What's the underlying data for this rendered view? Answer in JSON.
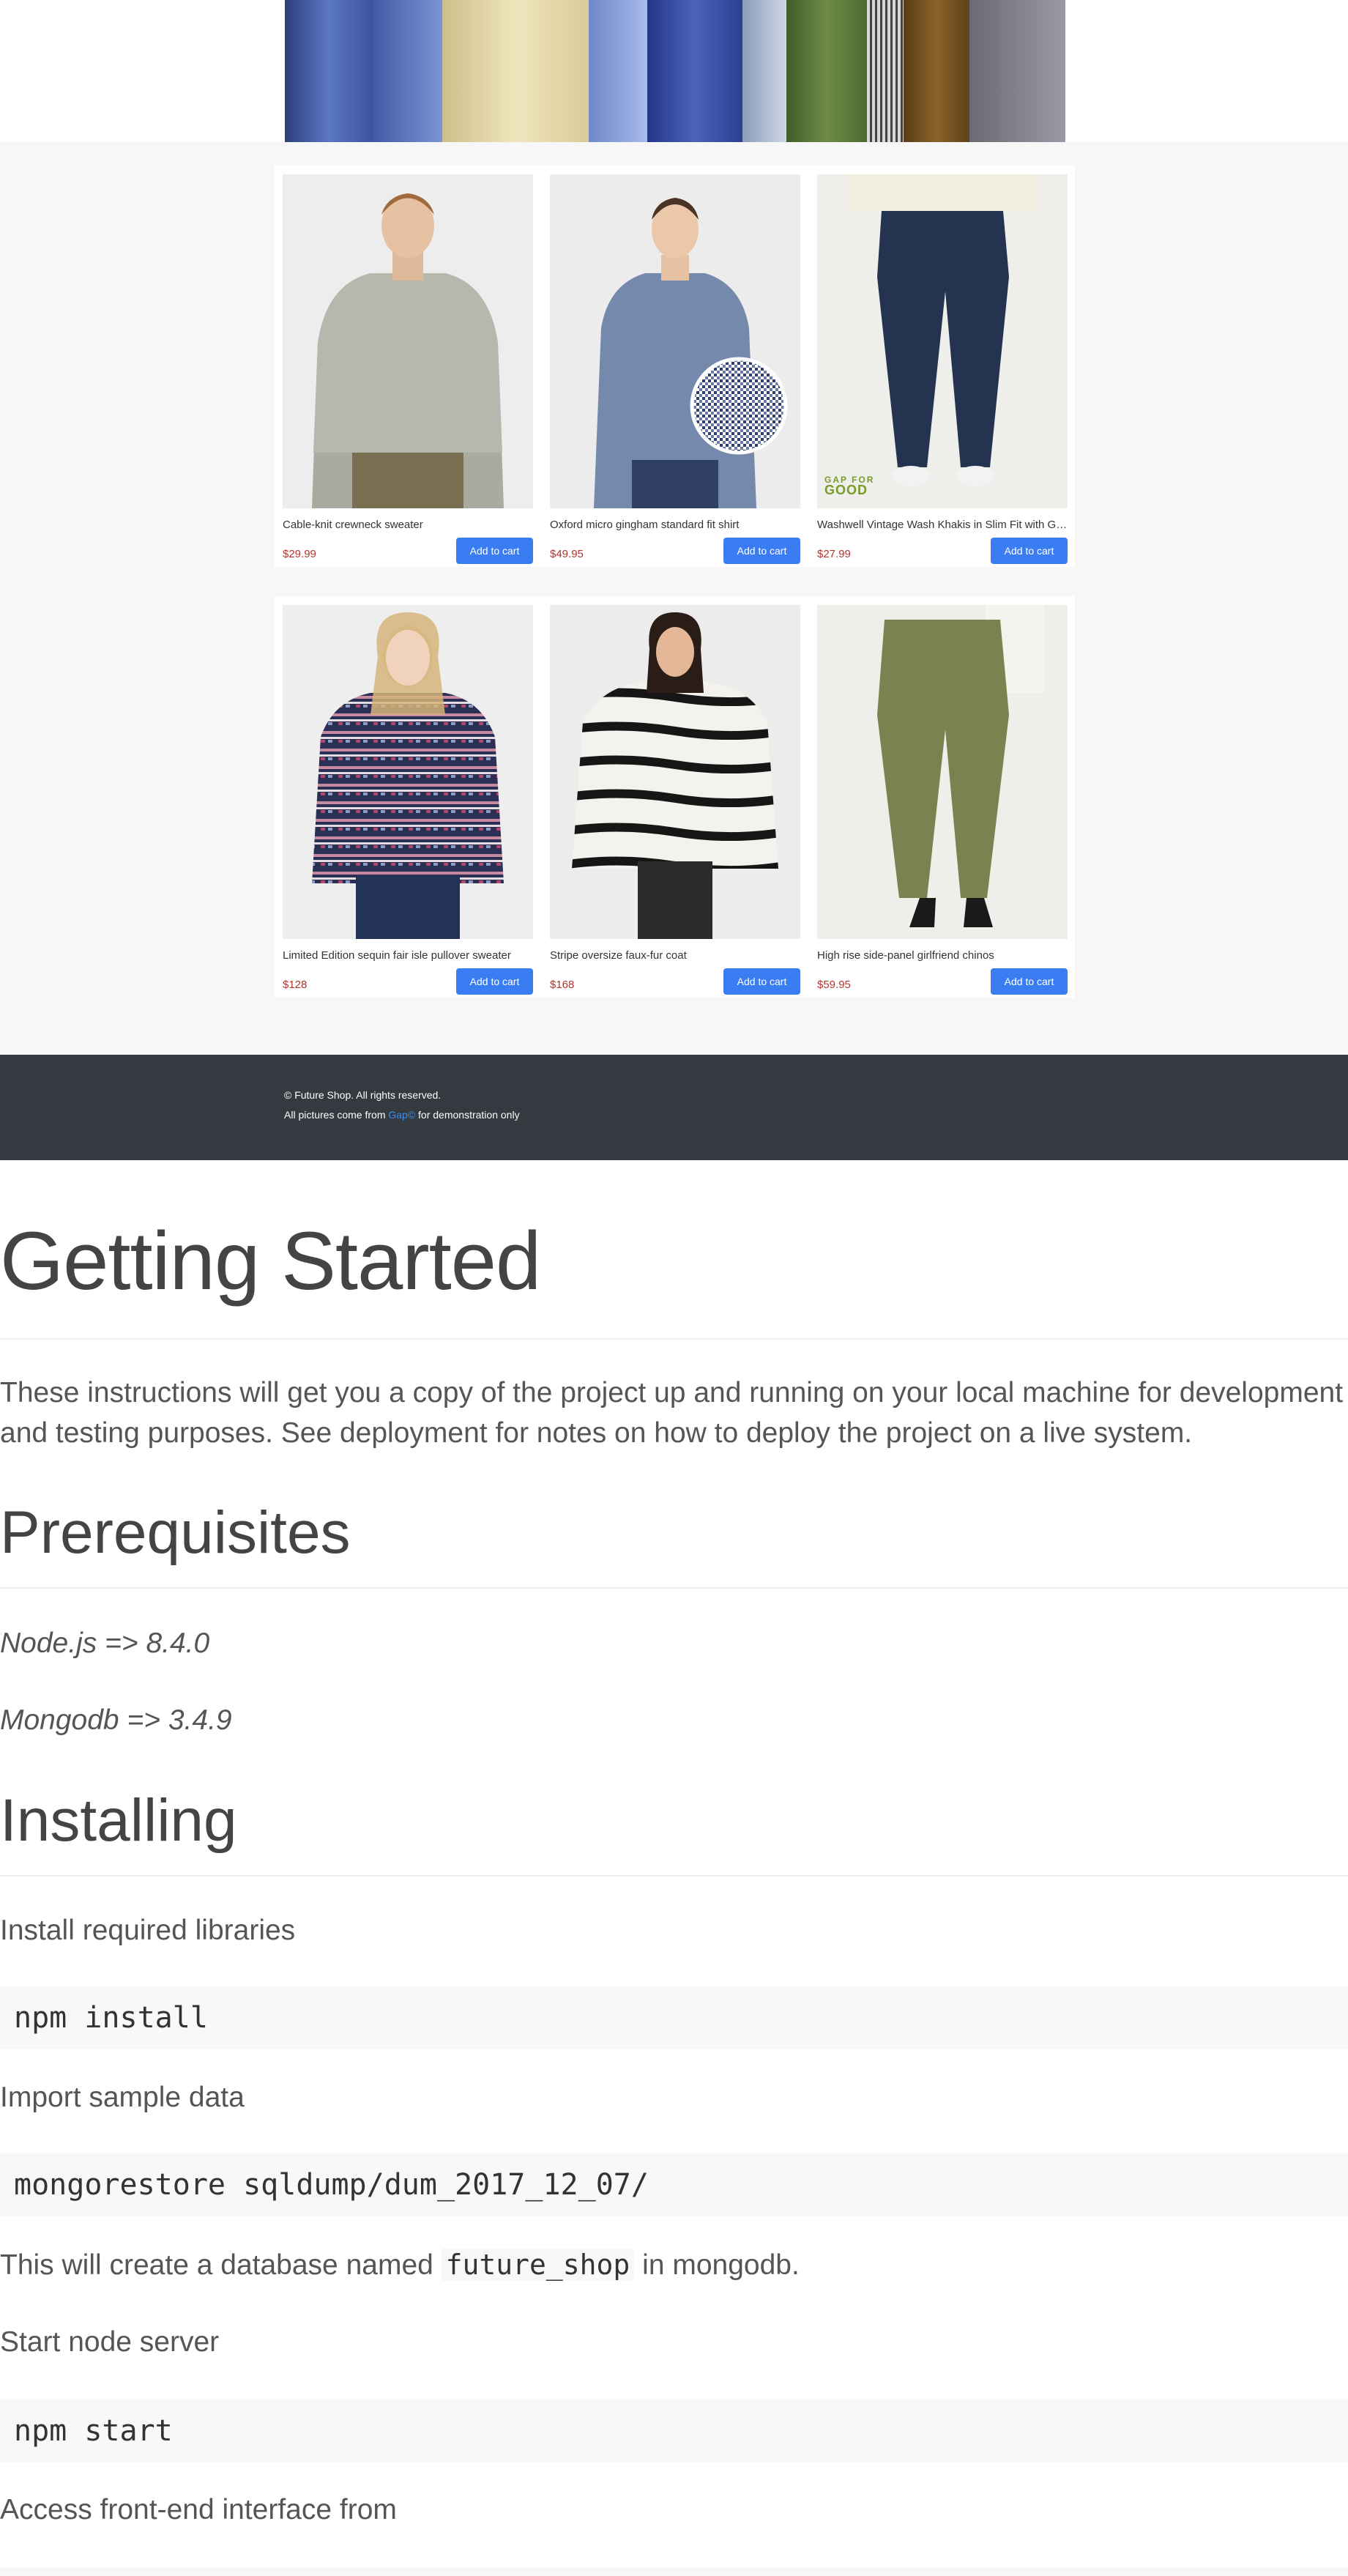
{
  "shop": {
    "products": [
      {
        "name": "Cable-knit crewneck sweater",
        "price": "$29.99",
        "cart_label": "Add to cart"
      },
      {
        "name": "Oxford micro gingham standard fit shirt",
        "price": "$49.95",
        "cart_label": "Add to cart"
      },
      {
        "name": "Washwell Vintage Wash Khakis in Slim Fit with GapFlex",
        "price": "$27.99",
        "cart_label": "Add to cart",
        "badge_top": "GAP FOR",
        "badge_bottom": "GOOD"
      },
      {
        "name": "Limited Edition sequin fair isle pullover sweater",
        "price": "$128",
        "cart_label": "Add to cart"
      },
      {
        "name": "Stripe oversize faux-fur coat",
        "price": "$168",
        "cart_label": "Add to cart"
      },
      {
        "name": "High rise side-panel girlfriend chinos",
        "price": "$59.95",
        "cart_label": "Add to cart"
      }
    ],
    "footer": {
      "copyright": "© Future Shop. All rights reserved.",
      "pictures_prefix": "All pictures come from ",
      "pictures_link": "Gap©",
      "pictures_suffix": " for demonstration only"
    }
  },
  "readme": {
    "title": "Getting Started",
    "intro_line1": "These instructions will get you a copy of the project up and running on your local machine for development",
    "intro_line2": "and testing purposes. See deployment for notes on how to deploy the project on a live system.",
    "prereq_heading": "Prerequisites",
    "prereq_node": "Node.js => 8.4.0",
    "prereq_mongo": "Mongodb => 3.4.9",
    "installing_heading": "Installing",
    "step_install_libs": "Install required libraries",
    "code_npm_install": "npm install",
    "step_import": "Import sample data",
    "code_mongorestore": "mongorestore sqldump/dum_2017_12_07/",
    "db_note_prefix": "This will create a database named ",
    "db_note_code": "future_shop",
    "db_note_suffix": " in mongodb.",
    "step_start": "Start node server",
    "code_npm_start": "npm start",
    "step_access": "Access front-end interface from"
  }
}
